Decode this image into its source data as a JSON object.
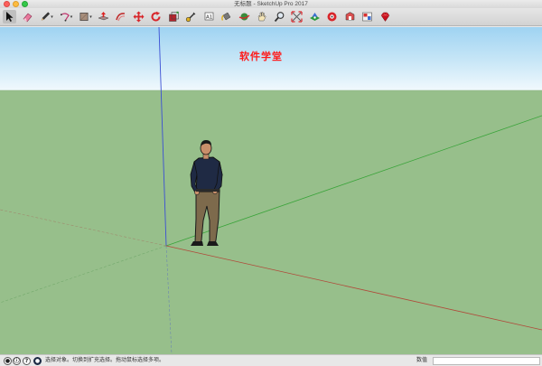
{
  "window": {
    "title": "无标题 - SketchUp Pro 2017"
  },
  "toolbar": {
    "tools": [
      {
        "name": "select-tool",
        "icon": "arrow-cursor-icon",
        "caret": false
      },
      {
        "name": "eraser-tool",
        "icon": "eraser-icon",
        "caret": false
      },
      {
        "name": "line-tool",
        "icon": "pencil-icon",
        "caret": true
      },
      {
        "name": "arc-tool",
        "icon": "arc-icon",
        "caret": true
      },
      {
        "name": "rectangle-tool",
        "icon": "rectangle-icon",
        "caret": true
      },
      {
        "name": "push-pull-tool",
        "icon": "push-pull-icon",
        "caret": false
      },
      {
        "name": "offset-tool",
        "icon": "offset-icon",
        "caret": false
      },
      {
        "name": "move-tool",
        "icon": "move-arrows-icon",
        "caret": false
      },
      {
        "name": "rotate-tool",
        "icon": "rotate-icon",
        "caret": false
      },
      {
        "name": "scale-tool",
        "icon": "scale-icon",
        "caret": false
      },
      {
        "name": "tape-measure-tool",
        "icon": "tape-measure-icon",
        "caret": false
      },
      {
        "name": "text-tool",
        "icon": "text-icon",
        "caret": false
      },
      {
        "name": "paint-bucket-tool",
        "icon": "paint-bucket-icon",
        "caret": false
      },
      {
        "name": "orbit-tool",
        "icon": "orbit-icon",
        "caret": false
      },
      {
        "name": "pan-tool",
        "icon": "hand-icon",
        "caret": false
      },
      {
        "name": "zoom-tool",
        "icon": "magnifier-icon",
        "caret": false
      },
      {
        "name": "zoom-extents-tool",
        "icon": "zoom-extents-icon",
        "caret": false
      },
      {
        "name": "3d-warehouse-tool",
        "icon": "warehouse-icon",
        "caret": false
      },
      {
        "name": "extension-warehouse-tool",
        "icon": "extension-icon",
        "caret": false
      },
      {
        "name": "share-model-tool",
        "icon": "share-model-icon",
        "caret": false
      },
      {
        "name": "layout-tool",
        "icon": "layout-icon",
        "caret": false
      },
      {
        "name": "ruby-tool",
        "icon": "ruby-icon",
        "caret": false
      }
    ]
  },
  "viewport": {
    "watermark": "软件学堂",
    "colors": {
      "sky_top": "#9fd3f2",
      "ground": "#97bf8b",
      "axis_red": "#b04a3a",
      "axis_green": "#3aa43a",
      "axis_blue": "#3b4fd4"
    }
  },
  "statusbar": {
    "icons": [
      "geo-location-icon",
      "credits-icon",
      "instructor-icon",
      "profile-icon"
    ],
    "icon_glyphs": [
      "●",
      "ⓘ",
      "?",
      "●"
    ],
    "message": "选择对象。切换到扩充选择。拖动鼠标选择多项。",
    "measurements_label": "数值",
    "measurements_value": ""
  }
}
